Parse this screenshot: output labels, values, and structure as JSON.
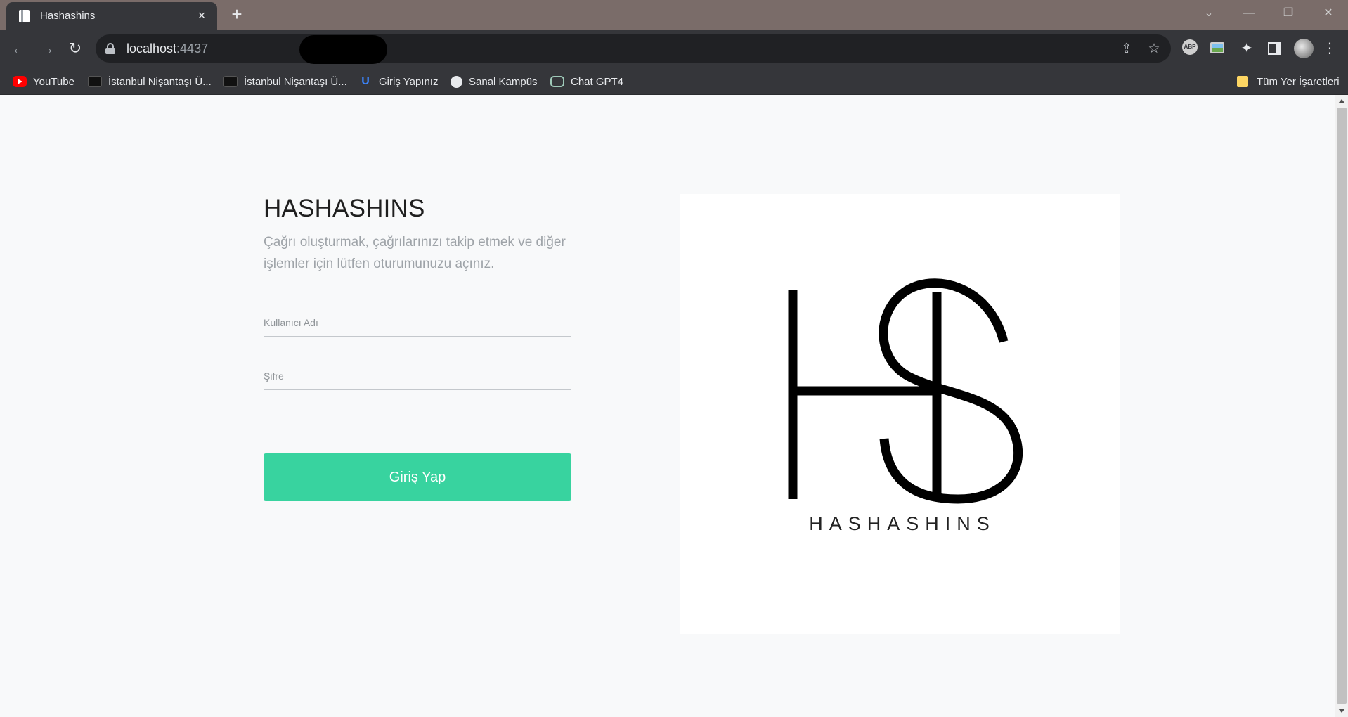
{
  "browser": {
    "tab": {
      "title": "Hashashins",
      "close_glyph": "×"
    },
    "new_tab_glyph": "+",
    "window_controls": {
      "dropdown": "⌄",
      "minimize": "—",
      "restore": "❐",
      "close": "✕"
    },
    "nav": {
      "back": "←",
      "forward": "→",
      "reload": "↻"
    },
    "address": {
      "host": "localhost",
      "port_visible": ":4437"
    },
    "omnibox_icons": {
      "share": "⇪",
      "bookmark": "☆"
    },
    "extensions": {
      "abp_label": "ABP",
      "puzzle": "✦",
      "menu": "⋮"
    },
    "bookmarks": [
      {
        "label": "YouTube",
        "icon": "youtube-icon"
      },
      {
        "label": "İstanbul Nişantaşı Ü...",
        "icon": "university-icon"
      },
      {
        "label": "İstanbul Nişantaşı Ü...",
        "icon": "university-icon"
      },
      {
        "label": "Giriş Yapınız",
        "icon": "u-logo-icon"
      },
      {
        "label": "Sanal Kampüs",
        "icon": "globe-icon"
      },
      {
        "label": "Chat GPT4",
        "icon": "chatgpt-icon"
      }
    ],
    "all_bookmarks": "Tüm Yer İşaretleri"
  },
  "login": {
    "title": "HASHASHINS",
    "subtitle": "Çağrı oluşturmak, çağrılarınızı takip etmek ve diğer işlemler için lütfen oturumunuzu açınız.",
    "username_placeholder": "Kullanıcı Adı",
    "password_placeholder": "Şifre",
    "submit_label": "Giriş Yap",
    "button_color": "#38d39f"
  },
  "logo": {
    "wordmark": "HASHASHINS"
  }
}
